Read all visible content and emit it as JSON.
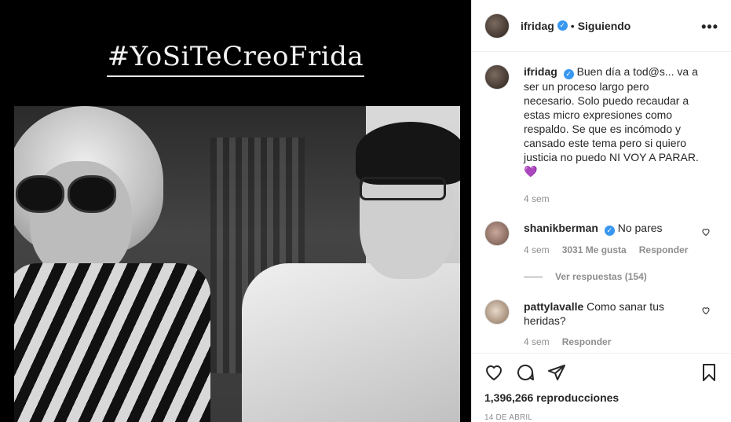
{
  "media": {
    "hashtag_title": "#YoSiTeCreoFrida"
  },
  "header": {
    "username": "ifridag",
    "separator": "•",
    "follow_status": "Siguiendo",
    "more_icon": "more-horizontal-icon"
  },
  "caption": {
    "username": "ifridag",
    "text": "Buen día a tod@s... va a ser un proceso largo pero necesario. Solo puedo recaudar a estas micro expresiones como respaldo. Se que es incómodo y cansado este tema pero si quiero justicia no puedo NI VOY A PARAR. 💜",
    "time": "4 sem"
  },
  "comments": [
    {
      "username": "shanikberman",
      "verified": true,
      "text": "No pares",
      "time": "4 sem",
      "likes": "3031 Me gusta",
      "reply": "Responder"
    },
    {
      "username": "pattylavalle",
      "verified": false,
      "text": "Como sanar tus heridas?",
      "time": "4 sem",
      "reply": "Responder"
    }
  ],
  "view_replies": "Ver respuestas (154)",
  "actions": {
    "icons": [
      "heart-icon",
      "comment-icon",
      "share-icon",
      "bookmark-icon"
    ]
  },
  "stats": {
    "views": "1,396,266 reproducciones",
    "date": "14 DE ABRIL"
  },
  "colors": {
    "verified": "#3897f0",
    "secondary_text": "#8e8e8e",
    "border": "#efefef"
  }
}
